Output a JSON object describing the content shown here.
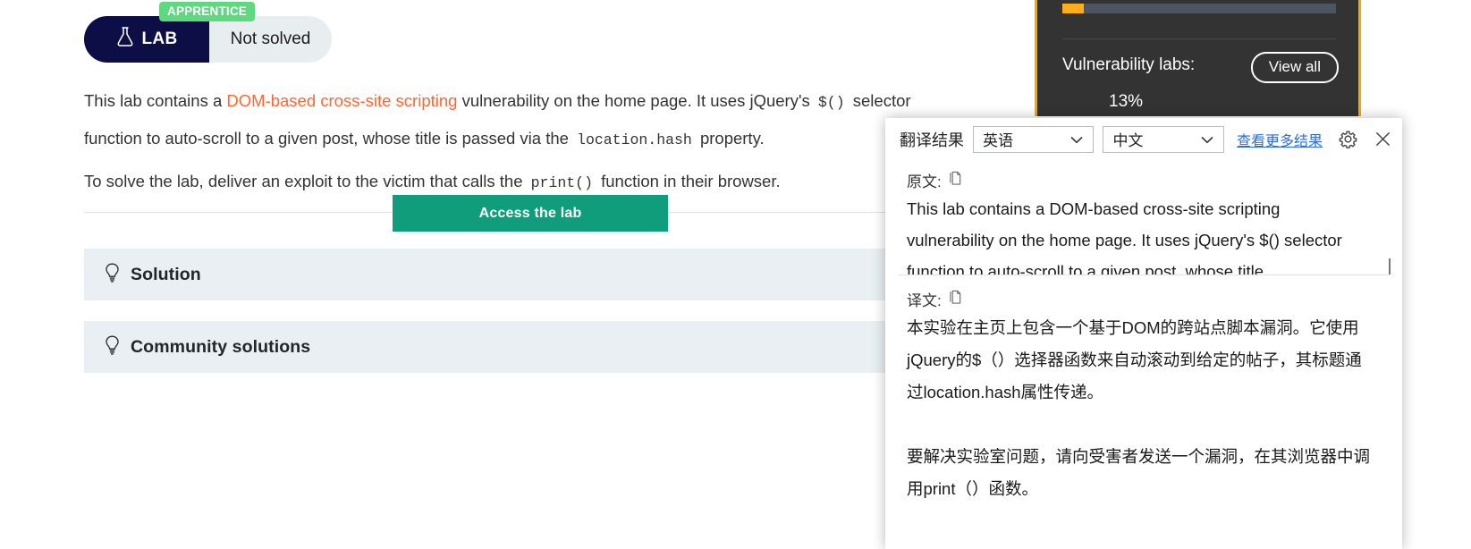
{
  "lab": {
    "badge": "APPRENTICE",
    "tag_label": "LAB",
    "status": "Not solved",
    "description_1_a": "This lab contains a ",
    "description_1_link": "DOM-based cross-site scripting",
    "description_1_b": " vulnerability on the home page. It uses jQuery's ",
    "description_1_code1": "$()",
    "description_1_c": " selector function to auto-scroll to a given post, whose title is passed via the ",
    "description_1_code2": "location.hash",
    "description_1_d": " property.",
    "description_2_a": "To solve the lab, deliver an exploit to the victim that calls the ",
    "description_2_code": "print()",
    "description_2_b": " function in their browser.",
    "access_button": "Access the lab",
    "accordions": [
      {
        "title": "Solution"
      },
      {
        "title": "Community solutions"
      }
    ]
  },
  "progress_widget": {
    "top_percent": "7%",
    "label": "Vulnerability labs:",
    "view_all": "View all",
    "bottom_percent": "13%",
    "accent_color": "#ffa500",
    "bar_fill_color": "#ffae1a",
    "background_color": "#333333"
  },
  "translator": {
    "title": "翻译结果",
    "source_language": "英语",
    "target_language": "中文",
    "more_results_link": "查看更多结果",
    "original_label": "原文:",
    "translated_label": "译文:",
    "original_text": "This lab contains a DOM-based cross-site scripting vulnerability on the home page. It uses jQuery's $() selector function to auto-scroll to a given post, whose title",
    "translated_text_1": "本实验在主页上包含一个基于DOM的跨站点脚本漏洞。它使用jQuery的$（）选择器函数来自动滚动到给定的帖子，其标题通过location.hash属性传递。",
    "translated_text_2": "要解决实验室问题，请向受害者发送一个漏洞，在其浏览器中调用print（）函数。",
    "link_color": "#2b6fd6"
  }
}
